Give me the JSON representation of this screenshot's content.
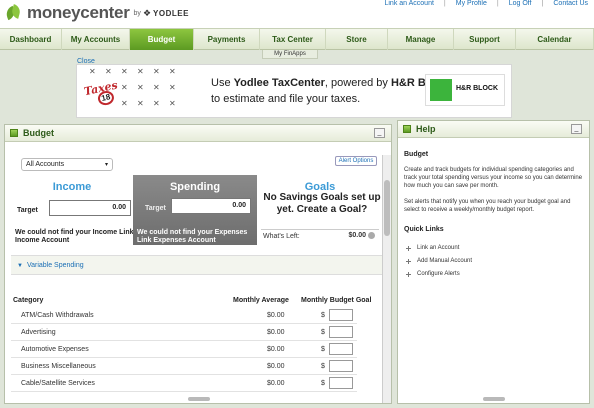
{
  "header": {
    "logo_text": "moneycenter",
    "by": "by",
    "yodlee": "YODLEE",
    "links": [
      "Link an Account",
      "My Profile",
      "Log Off",
      "Contact Us"
    ]
  },
  "nav": {
    "tabs": [
      {
        "label": "Dashboard"
      },
      {
        "label": "My Accounts"
      },
      {
        "label": "Budget"
      },
      {
        "label": "Payments"
      },
      {
        "label": "Tax Center"
      },
      {
        "label": "Store"
      },
      {
        "label": "Manage"
      },
      {
        "label": "Support"
      },
      {
        "label": "Calendar"
      }
    ],
    "active": "Budget",
    "subtab": "My FinApps"
  },
  "ad": {
    "close": "Close",
    "line1_pre": "Use ",
    "line1_bold": "Yodlee TaxCenter",
    "line1_mid": ", powered by ",
    "line1_bold2": "H&R Block",
    "line1_post": ",",
    "line2": "to estimate and file your taxes.",
    "taxes_word": "Taxes",
    "taxes_num": "18",
    "logo_text": "H&R BLOCK"
  },
  "budget": {
    "title": "Budget",
    "account_select": "All Accounts",
    "alert_options": "Alert Options",
    "income": {
      "title": "Income",
      "target_label": "Target",
      "target_value": "0.00",
      "message": "We could not find your Income Link Income Account"
    },
    "spending": {
      "title": "Spending",
      "target_label": "Target",
      "target_value": "0.00",
      "message": "We could not find your Expenses Link Expenses Account"
    },
    "goals": {
      "title": "Goals",
      "message": "No Savings Goals set up yet. Create a Goal?",
      "whats_left_label": "What's Left:",
      "whats_left_value": "$0.00"
    },
    "variable_spending": "Variable Spending",
    "table": {
      "headers": {
        "category": "Category",
        "monthly_average": "Monthly Average",
        "monthly_budget_goal": "Monthly Budget Goal"
      },
      "rows": [
        {
          "category": "ATM/Cash Withdrawals",
          "avg": "$0.00",
          "dollar": "$"
        },
        {
          "category": "Advertising",
          "avg": "$0.00",
          "dollar": "$"
        },
        {
          "category": "Automotive Expenses",
          "avg": "$0.00",
          "dollar": "$"
        },
        {
          "category": "Business Miscellaneous",
          "avg": "$0.00",
          "dollar": "$"
        },
        {
          "category": "Cable/Satellite Services",
          "avg": "$0.00",
          "dollar": "$"
        }
      ]
    }
  },
  "help": {
    "title": "Help",
    "section_title": "Budget",
    "p1": "Create and track budgets for individual spending categories and track your total spending versus your income so you can determine how much you can save per month.",
    "p2": "Set alerts that notify you when you reach your budget goal and select to receive a weekly/monthly budget report.",
    "quick_links_title": "Quick Links",
    "quick_links": [
      {
        "label": "Link an Account"
      },
      {
        "label": "Add Manual Account"
      },
      {
        "label": "Configure Alerts"
      }
    ]
  },
  "colors": {
    "brand_green": "#5c9a22",
    "link_blue": "#1b6fb5",
    "income_blue": "#3b9ad6"
  }
}
